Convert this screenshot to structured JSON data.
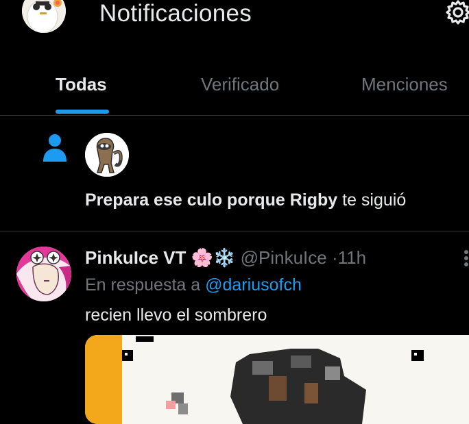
{
  "header": {
    "title": "Notificaciones",
    "avatar_icon": "cat-avatar",
    "settings_icon": "gear-icon"
  },
  "tabs": [
    {
      "label": "Todas",
      "active": true
    },
    {
      "label": "Verificado",
      "active": false
    },
    {
      "label": "Menciones",
      "active": false
    }
  ],
  "follow_notification": {
    "icon": "person-icon",
    "user_name": "Prepara ese culo porque Rigby",
    "action": "te siguió"
  },
  "reply_post": {
    "display_name": "PinkuIce VT",
    "emojis": "🌸❄️",
    "handle": "@PinkuIce",
    "separator": "·",
    "time": "11h",
    "reply_prefix": "En respuesta a",
    "reply_to": "@dariusofch",
    "text": "recien llevo el sombrero"
  },
  "colors": {
    "background": "#000000",
    "accent": "#1d9bf0",
    "text": "#e7e9ea",
    "muted": "#71767b",
    "divider": "#2f3336"
  }
}
